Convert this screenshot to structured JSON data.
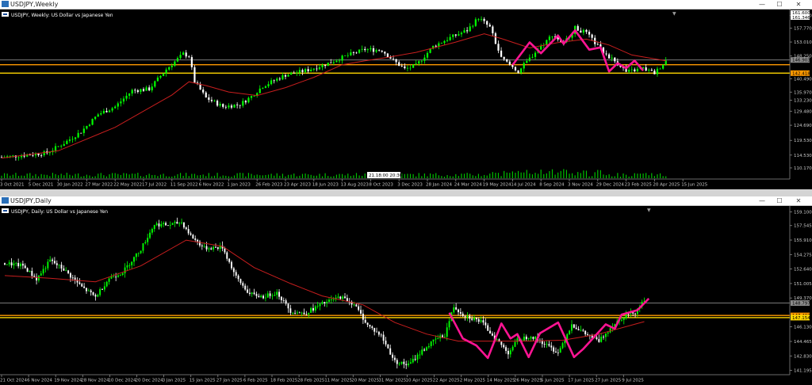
{
  "colors": {
    "bull": "#00ff00",
    "bear": "#ffffff",
    "ma": "#c81e1e",
    "zigzag": "#ff1493",
    "level_orange": "#ff9900",
    "level_yellow": "#ffd700",
    "level_grey": "#8a8a8a"
  },
  "weekly": {
    "window_title": "USDJPY,Weekly",
    "chart_label": "USDJPY, Weekly:  US Dollar vs Japanese Yen",
    "buttons": {
      "minimize": "—",
      "maximize": "☐",
      "close": "✕"
    },
    "price_labels": [
      "162.000",
      "157.770",
      "153.010",
      "148.250",
      "140.490",
      "135.970",
      "133.230",
      "129.480",
      "124.690",
      "119.530",
      "114.530",
      "110.170"
    ],
    "marker_prices": [
      "161.600",
      "161.346"
    ],
    "level_labels": [
      "146.903",
      "142.418"
    ],
    "volume_label": "21.18:00  20:30",
    "x_labels": [
      "3 Oct 2021",
      "5 Dec 2021",
      "30 Jan 2022",
      "27 Mar 2022",
      "22 May 2022",
      "17 Jul 2022",
      "11 Sep 2022",
      "6 Nov 2022",
      "1 Jan 2023",
      "26 Feb 2023",
      "23 Apr 2023",
      "18 Jun 2023",
      "13 Aug 2023",
      "8 Oct 2023",
      "3 Dec 2023",
      "28 Jan 2024",
      "24 Mar 2024",
      "19 May 2024",
      "14 Jul 2024",
      "8 Sep 2024",
      "3 Nov 2024",
      "29 Dec 2024",
      "23 Feb 2025",
      "20 Apr 2025",
      "15 Jun 2025"
    ]
  },
  "daily": {
    "window_title": "USDJPY,Daily",
    "chart_label": "USDJPY, Daily:  US Dollar vs Japanese Yen",
    "buttons": {
      "minimize": "—",
      "maximize": "☐",
      "close": "✕"
    },
    "price_labels": [
      "159.100",
      "157.545",
      "155.910",
      "154.275",
      "152.640",
      "151.005",
      "149.370",
      "146.130",
      "144.465",
      "142.830",
      "141.195"
    ],
    "level_labels": [
      "148.797",
      "147.403",
      "147.154"
    ],
    "x_labels": [
      "21 Oct 2024",
      "6 Nov 2024",
      "19 Nov 2024",
      "28 Nov 2024",
      "10 Dec 2024",
      "20 Dec 2024",
      "3 Jan 2025",
      "15 Jan 2025",
      "27 Jan 2025",
      "6 Feb 2025",
      "18 Feb 2025",
      "28 Feb 2025",
      "11 Mar 2025",
      "20 Mar 2025",
      "31 Mar 2025",
      "10 Apr 2025",
      "22 Apr 2025",
      "2 May 2025",
      "14 May 2025",
      "26 May 2025",
      "5 Jun 2025",
      "17 Jun 2025",
      "27 Jun 2025",
      "9 Jul 2025"
    ]
  },
  "chart_data": [
    {
      "type": "candlestick",
      "title": "USDJPY, Weekly: US Dollar vs Japanese Yen",
      "ylim": [
        108.0,
        163.0
      ],
      "x_labels_ref": "weekly.x_labels",
      "levels": [
        146.903,
        145.3,
        142.418
      ],
      "close_path": [
        [
          0,
          113.8
        ],
        [
          8,
          114.5
        ],
        [
          16,
          115.3
        ],
        [
          22,
          118.6
        ],
        [
          28,
          122.5
        ],
        [
          34,
          128.4
        ],
        [
          40,
          131.0
        ],
        [
          46,
          136.5
        ],
        [
          52,
          137.0
        ],
        [
          58,
          143.7
        ],
        [
          64,
          149.0
        ],
        [
          66,
          148.2
        ],
        [
          68,
          139.5
        ],
        [
          72,
          134.0
        ],
        [
          78,
          131.0
        ],
        [
          84,
          131.8
        ],
        [
          88,
          134.5
        ],
        [
          92,
          138.0
        ],
        [
          100,
          141.8
        ],
        [
          108,
          143.5
        ],
        [
          114,
          145.4
        ],
        [
          122,
          148.5
        ],
        [
          128,
          150.5
        ],
        [
          134,
          150.2
        ],
        [
          138,
          146.7
        ],
        [
          142,
          143.8
        ],
        [
          146,
          145.0
        ],
        [
          152,
          151.5
        ],
        [
          158,
          154.5
        ],
        [
          164,
          157.0
        ],
        [
          168,
          161.3
        ],
        [
          172,
          158.0
        ],
        [
          176,
          147.5
        ],
        [
          182,
          143.0
        ],
        [
          188,
          149.6
        ],
        [
          194,
          155.5
        ],
        [
          198,
          152.5
        ],
        [
          202,
          157.8
        ],
        [
          206,
          156.0
        ],
        [
          212,
          149.5
        ],
        [
          218,
          145.0
        ],
        [
          220,
          142.8
        ],
        [
          226,
          144.0
        ],
        [
          230,
          142.4
        ],
        [
          234,
          146.7
        ]
      ],
      "ma_path": [
        [
          0,
          113.5
        ],
        [
          20,
          116.0
        ],
        [
          40,
          124.0
        ],
        [
          60,
          135.0
        ],
        [
          66,
          139.5
        ],
        [
          72,
          138.2
        ],
        [
          80,
          136.0
        ],
        [
          90,
          134.8
        ],
        [
          100,
          137.5
        ],
        [
          110,
          141.0
        ],
        [
          120,
          145.3
        ],
        [
          128,
          146.6
        ],
        [
          136,
          147.8
        ],
        [
          146,
          149.5
        ],
        [
          160,
          153.0
        ],
        [
          170,
          155.8
        ],
        [
          176,
          154.2
        ],
        [
          186,
          151.0
        ],
        [
          196,
          152.8
        ],
        [
          206,
          154.0
        ],
        [
          214,
          152.0
        ],
        [
          222,
          148.6
        ],
        [
          234,
          146.6
        ]
      ],
      "zigzag": [
        [
          180,
          145.2
        ],
        [
          186,
          152.9
        ],
        [
          190,
          149.2
        ],
        [
          196,
          155.2
        ],
        [
          198,
          152.4
        ],
        [
          202,
          157.0
        ],
        [
          207,
          150.4
        ],
        [
          211,
          151.2
        ],
        [
          214,
          143.0
        ],
        [
          217,
          145.8
        ],
        [
          220,
          144.1
        ],
        [
          223,
          146.7
        ],
        [
          226,
          143.3
        ]
      ]
    },
    {
      "type": "candlestick",
      "title": "USDJPY, Daily: US Dollar vs Japanese Yen",
      "ylim": [
        140.8,
        159.4
      ],
      "x_labels_ref": "daily.x_labels",
      "levels": [
        148.797,
        147.403,
        147.154
      ],
      "close_path": [
        [
          0,
          153.3
        ],
        [
          8,
          153.0
        ],
        [
          14,
          151.5
        ],
        [
          20,
          153.6
        ],
        [
          26,
          152.6
        ],
        [
          34,
          150.6
        ],
        [
          40,
          149.5
        ],
        [
          46,
          151.6
        ],
        [
          52,
          152.3
        ],
        [
          60,
          154.9
        ],
        [
          66,
          157.7
        ],
        [
          72,
          157.6
        ],
        [
          78,
          157.9
        ],
        [
          82,
          156.4
        ],
        [
          88,
          155.0
        ],
        [
          96,
          155.1
        ],
        [
          102,
          151.7
        ],
        [
          108,
          149.8
        ],
        [
          114,
          149.5
        ],
        [
          120,
          150.0
        ],
        [
          126,
          147.9
        ],
        [
          132,
          147.6
        ],
        [
          140,
          148.7
        ],
        [
          148,
          149.5
        ],
        [
          154,
          148.7
        ],
        [
          160,
          146.3
        ],
        [
          166,
          145.1
        ],
        [
          172,
          142.2
        ],
        [
          178,
          141.8
        ],
        [
          184,
          143.4
        ],
        [
          190,
          144.7
        ],
        [
          194,
          145.2
        ],
        [
          198,
          148.4
        ],
        [
          202,
          147.5
        ],
        [
          210,
          146.7
        ],
        [
          216,
          144.9
        ],
        [
          222,
          143.2
        ],
        [
          226,
          144.6
        ],
        [
          232,
          145.1
        ],
        [
          238,
          144.2
        ],
        [
          244,
          143.2
        ],
        [
          250,
          146.4
        ],
        [
          256,
          145.3
        ],
        [
          262,
          144.5
        ],
        [
          268,
          146.3
        ],
        [
          274,
          147.5
        ],
        [
          278,
          147.8
        ],
        [
          282,
          149.2
        ]
      ],
      "ma_path": [
        [
          0,
          151.9
        ],
        [
          20,
          151.6
        ],
        [
          40,
          151.2
        ],
        [
          60,
          153.0
        ],
        [
          80,
          155.9
        ],
        [
          96,
          155.2
        ],
        [
          110,
          152.8
        ],
        [
          126,
          151.0
        ],
        [
          140,
          149.6
        ],
        [
          158,
          148.6
        ],
        [
          172,
          146.6
        ],
        [
          186,
          145.3
        ],
        [
          200,
          144.5
        ],
        [
          214,
          144.5
        ],
        [
          230,
          144.5
        ],
        [
          246,
          144.6
        ],
        [
          262,
          145.3
        ],
        [
          282,
          146.7
        ]
      ],
      "zigzag": [
        [
          196,
          147.7
        ],
        [
          202,
          144.8
        ],
        [
          208,
          144.0
        ],
        [
          213,
          142.6
        ],
        [
          219,
          146.5
        ],
        [
          223,
          144.8
        ],
        [
          226,
          145.3
        ],
        [
          231,
          142.7
        ],
        [
          236,
          145.4
        ],
        [
          244,
          146.6
        ],
        [
          251,
          142.7
        ],
        [
          255,
          143.6
        ],
        [
          265,
          146.4
        ],
        [
          269,
          145.9
        ],
        [
          272,
          147.5
        ],
        [
          279,
          148.0
        ],
        [
          284,
          149.3
        ]
      ]
    }
  ]
}
